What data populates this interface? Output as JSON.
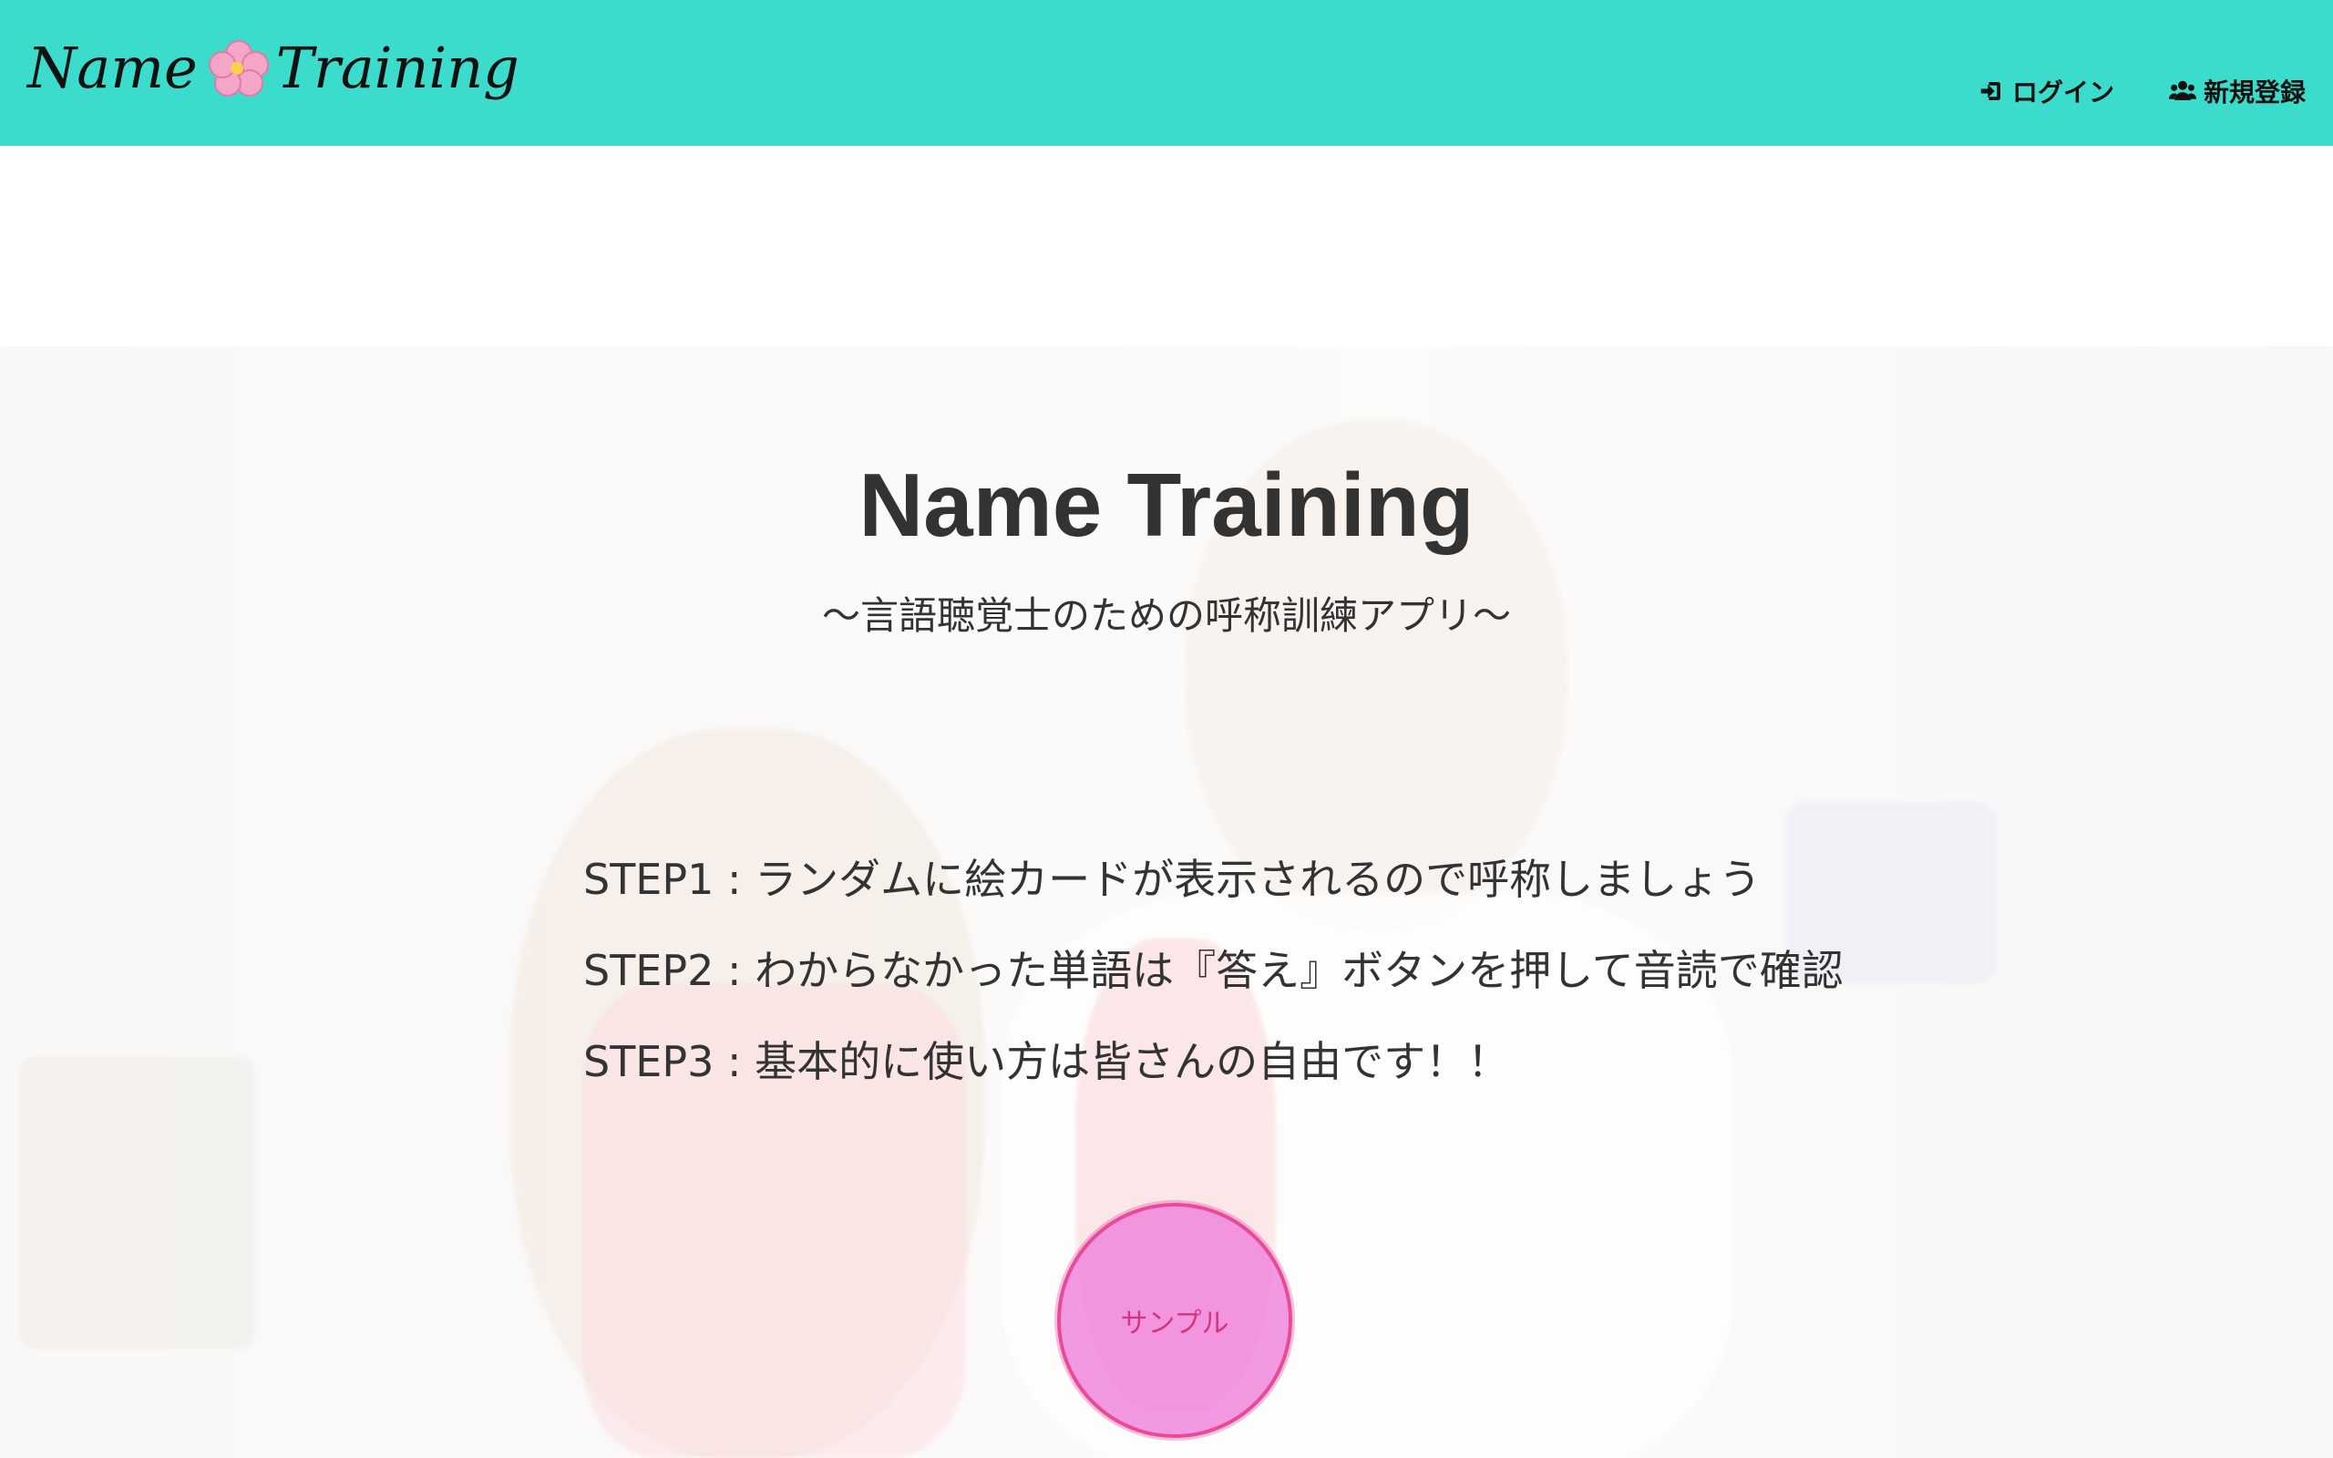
{
  "navbar": {
    "brand_left": "Name",
    "brand_right": "Training",
    "brand_icon": "cherry-blossom-icon",
    "links": [
      {
        "label": "ログイン",
        "icon": "sign-in-icon"
      },
      {
        "label": "新規登録",
        "icon": "users-icon"
      }
    ],
    "color": "#3bdccb"
  },
  "hero": {
    "title": "Name Training",
    "subtitle": "〜言語聴覚士のための呼称訓練アプリ〜",
    "steps": [
      "STEP1 : ランダムに絵カードが表示されるので呼称しましょう",
      "STEP2 : わからなかった単語は『答え』ボタンを押して音読で確認",
      "STEP3 : 基本的に使い方は皆さんの自由です！！"
    ],
    "sample_button_label": "サンプル"
  }
}
